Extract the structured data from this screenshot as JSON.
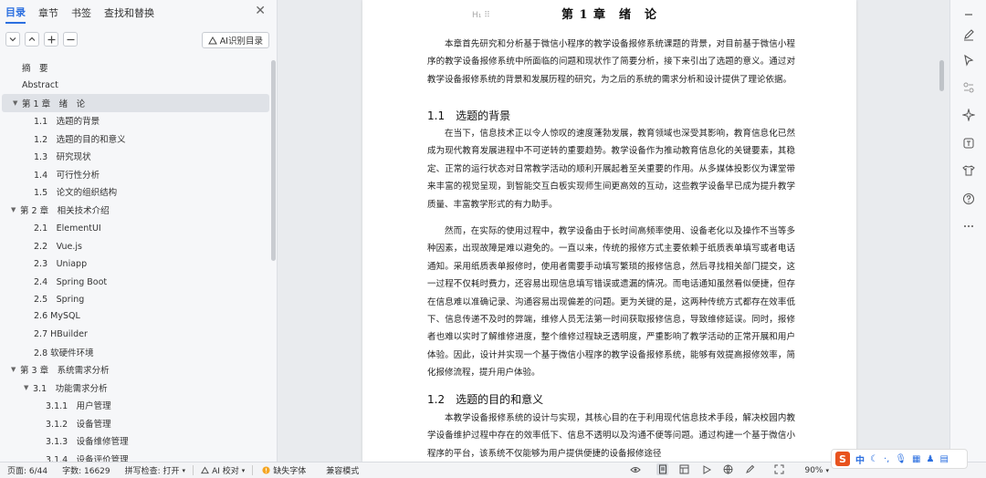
{
  "nav": {
    "tabs": [
      "目录",
      "章节",
      "书签",
      "查找和替换"
    ],
    "ai_toc_label": "AI识别目录",
    "toc": [
      {
        "label": "摘　要",
        "indent": 0,
        "arrow": ""
      },
      {
        "label": "Abstract",
        "indent": 0,
        "arrow": ""
      },
      {
        "label": "第 1 章　绪　论",
        "indent": 0,
        "arrow": "▼",
        "active": true
      },
      {
        "label": "1.1　选题的背景",
        "indent": 1,
        "arrow": ""
      },
      {
        "label": "1.2　选题的目的和意义",
        "indent": 1,
        "arrow": ""
      },
      {
        "label": "1.3　研究现状",
        "indent": 1,
        "arrow": ""
      },
      {
        "label": "1.4　可行性分析",
        "indent": 1,
        "arrow": ""
      },
      {
        "label": "1.5　论文的组织结构",
        "indent": 1,
        "arrow": ""
      },
      {
        "label": "第 2 章　相关技术介绍",
        "indent": 0,
        "arrow": "▼"
      },
      {
        "label": "2.1　ElementUI",
        "indent": 1,
        "arrow": ""
      },
      {
        "label": "2.2　Vue.js",
        "indent": 1,
        "arrow": ""
      },
      {
        "label": "2.3　Uniapp",
        "indent": 1,
        "arrow": ""
      },
      {
        "label": "2.4　Spring Boot",
        "indent": 1,
        "arrow": ""
      },
      {
        "label": "2.5　Spring",
        "indent": 1,
        "arrow": ""
      },
      {
        "label": "2.6 MySQL",
        "indent": 1,
        "arrow": ""
      },
      {
        "label": "2.7 HBuilder",
        "indent": 1,
        "arrow": ""
      },
      {
        "label": "2.8 软硬件环境",
        "indent": 1,
        "arrow": ""
      },
      {
        "label": "第 3 章　系统需求分析",
        "indent": 0,
        "arrow": "▼"
      },
      {
        "label": "3.1　功能需求分析",
        "indent": 1,
        "arrow": "▼"
      },
      {
        "label": "3.1.1　用户管理",
        "indent": 2,
        "arrow": ""
      },
      {
        "label": "3.1.2　设备管理",
        "indent": 2,
        "arrow": ""
      },
      {
        "label": "3.1.3　设备维修管理",
        "indent": 2,
        "arrow": ""
      },
      {
        "label": "3.1.4　设备评价管理",
        "indent": 2,
        "arrow": ""
      }
    ]
  },
  "doc": {
    "chapter_title": "第 1 章　绪　论",
    "intro": "本章首先研究和分析基于微信小程序的教学设备报修系统课题的背景，对目前基于微信小程序的教学设备报修系统中所面临的问题和现状作了简要分析，接下来引出了选题的意义。通过对教学设备报修系统的背景和发展历程的研究，为之后的系统的需求分析和设计提供了理论依据。",
    "sec1_title": "1.1　选题的背景",
    "sec1_p1": "在当下，信息技术正以令人惊叹的速度蓬勃发展，教育领域也深受其影响，教育信息化已然成为现代教育发展进程中不可逆转的重要趋势。教学设备作为推动教育信息化的关键要素，其稳定、正常的运行状态对日常教学活动的顺利开展起着至关重要的作用。从多媒体投影仪为课堂带来丰富的视觉呈现，到智能交互白板实现师生间更高效的互动，这些教学设备早已成为提升教学质量、丰富教学形式的有力助手。",
    "sec1_p2": "然而，在实际的使用过程中，教学设备由于长时间高频率使用、设备老化以及操作不当等多种因素，出现故障是难以避免的。一直以来，传统的报修方式主要依赖于纸质表单填写或者电话通知。采用纸质表单报修时，使用者需要手动填写繁琐的报修信息，然后寻找相关部门提交，这一过程不仅耗时费力，还容易出现信息填写错误或遗漏的情况。而电话通知虽然看似便捷，但存在信息难以准确记录、沟通容易出现偏差的问题。更为关键的是，这两种传统方式都存在效率低下、信息传递不及时的弊端，维修人员无法第一时间获取报修信息，导致维修延误。同时，报修者也难以实时了解维修进度，整个维修过程缺乏透明度，严重影响了教学活动的正常开展和用户体验。因此，设计并实现一个基于微信小程序的教学设备报修系统，能够有效提高报修效率，简化报修流程，提升用户体验。",
    "sec2_title": "1.2　选题的目的和意义",
    "sec2_p1": "本教学设备报修系统的设计与实现，其核心目的在于利用现代信息技术手段，解决校园内教学设备维护过程中存在的效率低下、信息不透明以及沟通不便等问题。通过构建一个基于微信小程序的平台，该系统不仅能够为用户提供便捷的设备报修途径"
  },
  "status": {
    "page": "页面: 6/44",
    "words": "字数: 16629",
    "spell": "拼写检查: 打开",
    "ai_check": "AI 校对",
    "missing_font": "缺失字体",
    "compat": "兼容模式",
    "zoom": "90%"
  },
  "ime": {
    "label": "中"
  },
  "colors": {
    "accent": "#2b6fe0",
    "panel": "#f6f7f9",
    "canvas": "#e9ebee",
    "warning": "#f5a623",
    "ime": "#e8531e"
  }
}
